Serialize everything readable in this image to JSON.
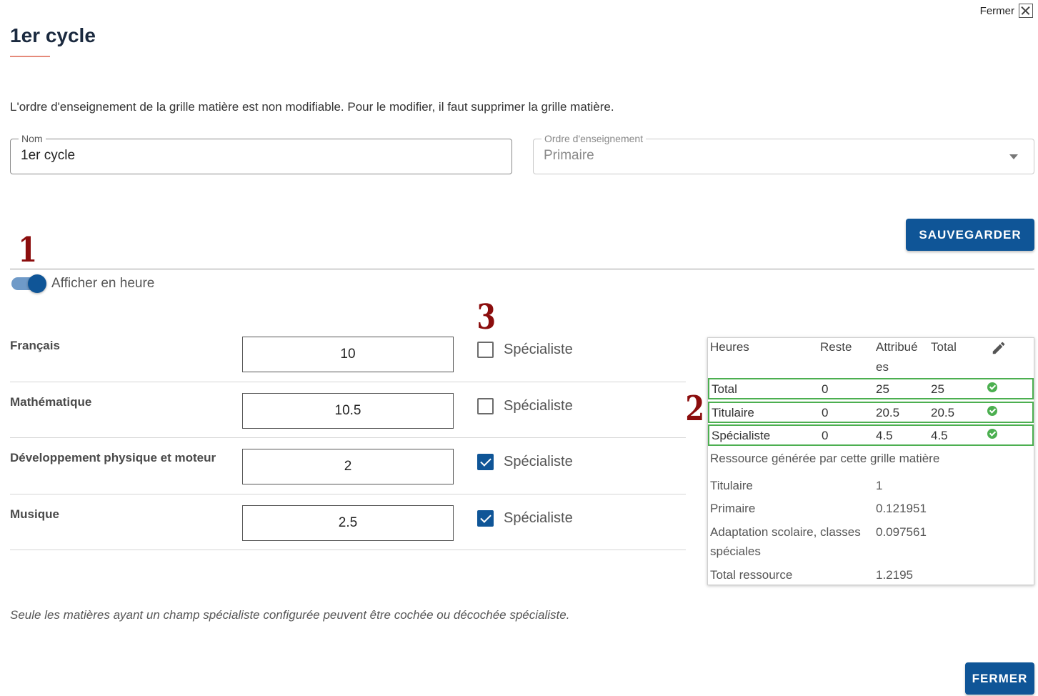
{
  "header": {
    "close_top_label": "Fermer",
    "title": "1er cycle",
    "info": "L'ordre d'enseignement de la grille matière est non modifiable. Pour le modifier, il faut supprimer la grille matière."
  },
  "form": {
    "nom_label": "Nom",
    "nom_value": "1er cycle",
    "ordre_label": "Ordre d'enseignement",
    "ordre_value": "Primaire"
  },
  "save_label": "SAUVEGARDER",
  "markers": [
    "1",
    "2",
    "3"
  ],
  "toggle": {
    "label": "Afficher en heure",
    "on": true
  },
  "subjects": [
    {
      "name": "Français",
      "value": "10",
      "specialist_label": "Spécialiste",
      "checked": false
    },
    {
      "name": "Mathématique",
      "value": "10.5",
      "specialist_label": "Spécialiste",
      "checked": false
    },
    {
      "name": "Développement physique et moteur",
      "value": "2",
      "specialist_label": "Spécialiste",
      "checked": true
    },
    {
      "name": "Musique",
      "value": "2.5",
      "specialist_label": "Spécialiste",
      "checked": true
    }
  ],
  "footnote": "Seule les matières ayant un champ spécialiste configurée peuvent être cochée ou décochée spécialiste.",
  "summary": {
    "headers": {
      "heures": "Heures",
      "reste": "Reste",
      "attribuees_1": "Attribué",
      "attribuees_2": "es",
      "total": "Total"
    },
    "rows": [
      {
        "label": "Total",
        "reste": "0",
        "attribuees": "25",
        "total": "25"
      },
      {
        "label": "Titulaire",
        "reste": "0",
        "attribuees": "20.5",
        "total": "20.5"
      },
      {
        "label": "Spécialiste",
        "reste": "0",
        "attribuees": "4.5",
        "total": "4.5"
      }
    ],
    "resource_title": "Ressource générée par cette grille matière",
    "resources": [
      {
        "label": "Titulaire",
        "value": "1"
      },
      {
        "label": "Primaire",
        "value": "0.121951"
      },
      {
        "label": "Adaptation scolaire, classes",
        "label2": "spéciales",
        "value": "0.097561"
      },
      {
        "label": "Total ressource",
        "value": "1.2195"
      }
    ]
  },
  "close_label": "FERMER",
  "colors": {
    "primary": "#0f5597",
    "accent_underline": "#e58a7a",
    "ok_green": "#4caf50",
    "marker_red": "#8b0d0d"
  }
}
